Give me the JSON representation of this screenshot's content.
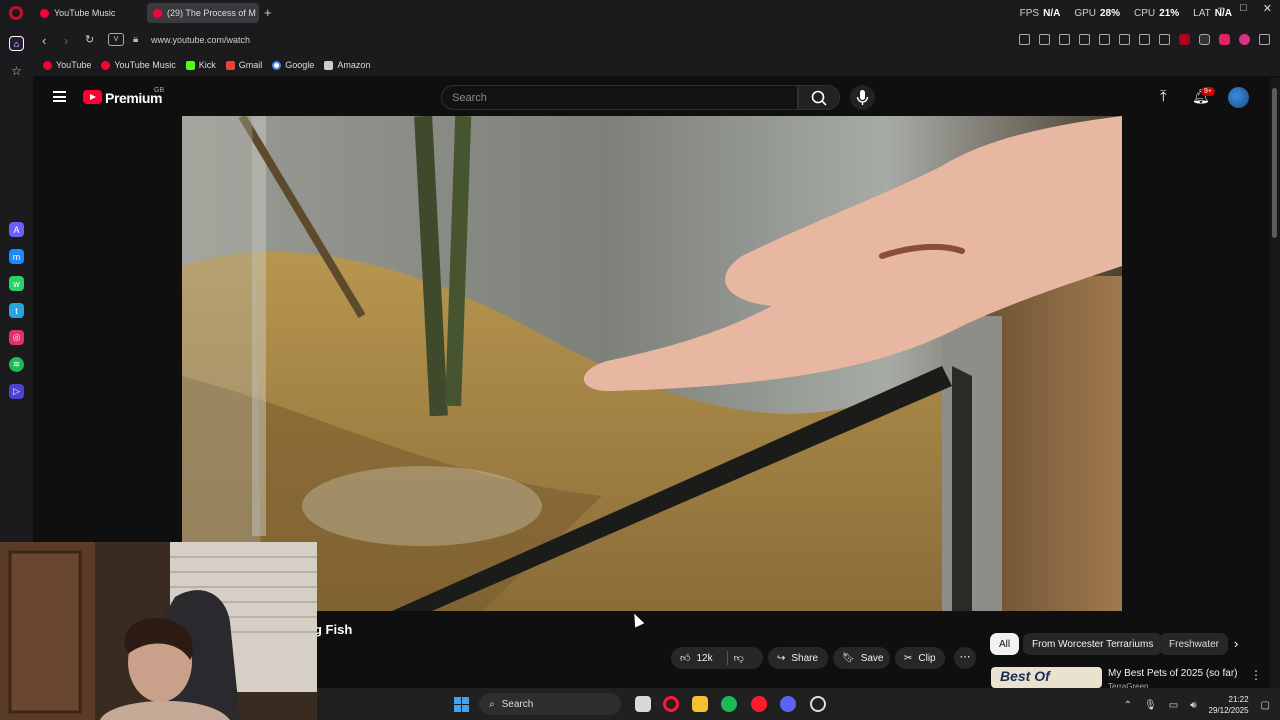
{
  "browser": {
    "tabs": [
      {
        "label": "YouTube Music"
      },
      {
        "label": "(29) The Process of M"
      }
    ],
    "perf": {
      "fps_label": "FPS",
      "fps_value": "N/A",
      "gpu_label": "GPU",
      "gpu_value": "28%",
      "cpu_label": "CPU",
      "cpu_value": "21%",
      "lat_label": "LAT",
      "lat_value": "N/A"
    },
    "url": "www.youtube.com/watch",
    "vpn_badge": "V",
    "bookmarks": [
      {
        "label": "YouTube",
        "color": "#ff0033"
      },
      {
        "label": "YouTube Music",
        "color": "#ff0033"
      },
      {
        "label": "Kick",
        "color": "#53fc18"
      },
      {
        "label": "Gmail",
        "color": "#ea4335"
      },
      {
        "label": "Google",
        "color": "#4285f4"
      },
      {
        "label": "Amazon",
        "color": "#cccccc"
      }
    ]
  },
  "youtube": {
    "brand": "Premium",
    "region": "GB",
    "search_placeholder": "Search",
    "notifications": "9+",
    "video_title": "g Fish",
    "actions": {
      "likes": "12k",
      "share": "Share",
      "save": "Save",
      "clip": "Clip"
    },
    "chips": [
      "All",
      "From Worcester Terrariums",
      "Freshwater"
    ],
    "recommendation": {
      "thumb_text": "Best Of",
      "title": "My Best Pets of 2025 (so far)",
      "channel": "TerraGreen"
    }
  },
  "taskbar": {
    "search_label": "Search",
    "time": "21:22",
    "date": "29/12/2025"
  },
  "colors": {
    "yt_red": "#ff0033",
    "background": "#0f0f0f",
    "opera_red": "#c8102e"
  }
}
